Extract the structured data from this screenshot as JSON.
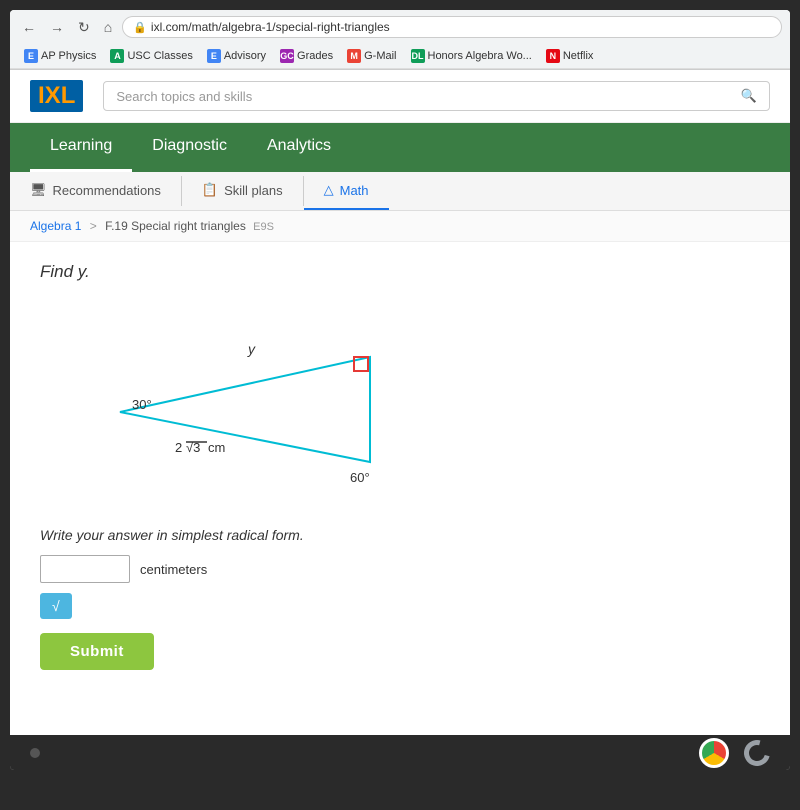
{
  "browser": {
    "back_label": "←",
    "forward_label": "→",
    "refresh_label": "↻",
    "home_label": "⌂",
    "address": "ixl.com/math/algebra-1/special-right-triangles",
    "lock_icon": "🔒"
  },
  "bookmarks": [
    {
      "label": "AP Physics",
      "color": "#4285f4",
      "letter": "E"
    },
    {
      "label": "USC Classes",
      "color": "#0f9d58",
      "letter": "A"
    },
    {
      "label": "Advisory",
      "color": "#4285f4",
      "letter": "E"
    },
    {
      "label": "Grades",
      "color": "#9c27b0",
      "letter": "GC"
    },
    {
      "label": "G-Mail",
      "color": "#ea4335",
      "letter": "M"
    },
    {
      "label": "Honors Algebra Wo...",
      "color": "#0f9d58",
      "letter": "DL"
    },
    {
      "label": "Netflix",
      "color": "#e50914",
      "letter": "N"
    }
  ],
  "header": {
    "logo_text": "IXL",
    "search_placeholder": "Search topics and skills"
  },
  "nav": {
    "tabs": [
      {
        "label": "Learning",
        "active": true
      },
      {
        "label": "Diagnostic",
        "active": false
      },
      {
        "label": "Analytics",
        "active": false
      }
    ]
  },
  "sub_nav": {
    "items": [
      {
        "label": "Recommendations",
        "icon": "🖥",
        "active": false
      },
      {
        "label": "Skill plans",
        "icon": "📋",
        "active": false
      },
      {
        "label": "Math",
        "icon": "△",
        "active": true
      }
    ]
  },
  "breadcrumb": {
    "parent": "Algebra 1",
    "separator": ">",
    "current": "F.19 Special right triangles",
    "code": "E9S"
  },
  "problem": {
    "prompt": "Find y.",
    "angles": {
      "top_left": "30°",
      "bottom_right": "60°"
    },
    "side_label": "2√3  cm",
    "hypotenuse_label": "y",
    "right_angle_marker": "⊓",
    "instruction": "Write your answer in simplest radical form.",
    "unit": "centimeters",
    "answer_placeholder": "",
    "sqrt_button_label": "√",
    "submit_label": "Submit"
  }
}
